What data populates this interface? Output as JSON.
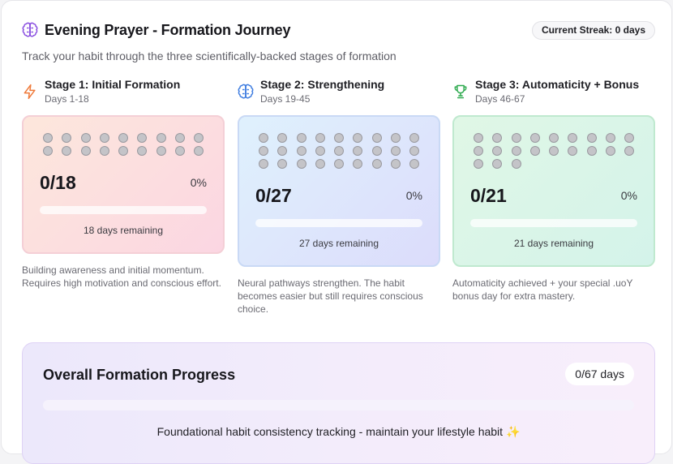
{
  "header": {
    "title": "Evening Prayer - Formation Journey",
    "streak": "Current Streak: 0 days",
    "subtitle": "Track your habit through the three scientifically-backed stages of formation",
    "icon": "brain-icon"
  },
  "stages": [
    {
      "icon": "lightning-icon",
      "title": "Stage 1: Initial Formation",
      "days": "Days 1-18",
      "total_days": 18,
      "completed_days": 0,
      "count": "0/18",
      "percent": "0%",
      "progress": 0,
      "remaining": "18 days remaining",
      "description": "Building awareness and initial momentum. Requires high motivation and conscious effort.",
      "colors": {
        "border": "#f4cfd6",
        "bg_from": "#fde7dc",
        "bg_to": "#fbd6e2",
        "icon": "#ef7a3a"
      }
    },
    {
      "icon": "brain-icon",
      "title": "Stage 2: Strengthening",
      "days": "Days 19-45",
      "total_days": 27,
      "completed_days": 0,
      "count": "0/27",
      "percent": "0%",
      "progress": 0,
      "remaining": "27 days remaining",
      "description": "Neural pathways strengthen. The habit becomes easier but still requires conscious choice.",
      "colors": {
        "border": "#c9d9f5",
        "bg_from": "#dff1fd",
        "bg_to": "#dcdcfb",
        "icon": "#3f7de0"
      }
    },
    {
      "icon": "trophy-icon",
      "title": "Stage 3: Automaticity + Bonus",
      "days": "Days 46-67",
      "total_days": 21,
      "completed_days": 0,
      "count": "0/21",
      "percent": "0%",
      "progress": 0,
      "remaining": "21 days remaining",
      "description": "Automaticity achieved + your special .uoY bonus day for extra mastery.",
      "colors": {
        "border": "#bfe9cf",
        "bg_from": "#e0f7e6",
        "bg_to": "#d4f3ea",
        "icon": "#2eaa4f"
      }
    }
  ],
  "overall": {
    "title": "Overall Formation Progress",
    "badge": "0/67 days",
    "progress": 0,
    "message": "Foundational habit consistency tracking - maintain your lifestyle habit",
    "message_icon": "sparkle-icon"
  }
}
